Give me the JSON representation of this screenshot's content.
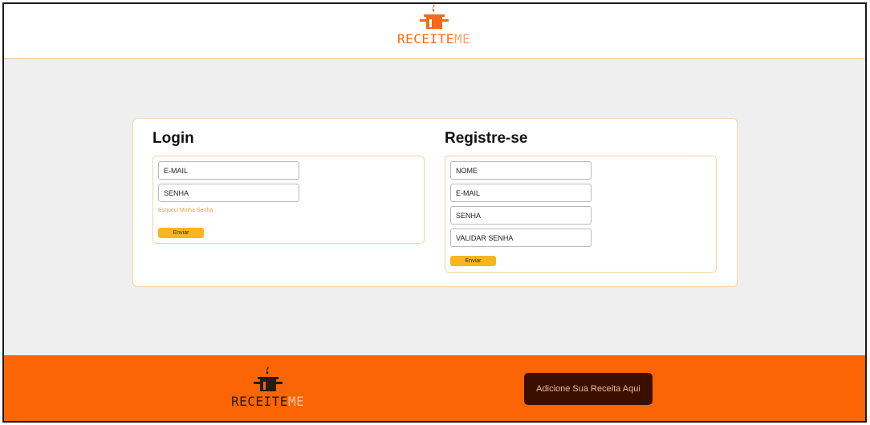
{
  "brand": {
    "name_part1": "RECEITE",
    "name_part2": "ME",
    "steam_glyph": "♦",
    "accent_color": "#f26b1d",
    "footer_color": "#fb6505"
  },
  "login": {
    "title": "Login",
    "email_placeholder": "E-MAIL",
    "password_placeholder": "SENHA",
    "forgot_link": "Esqueci Minha Senha",
    "submit_label": "Enviar"
  },
  "register": {
    "title": "Registre-se",
    "name_placeholder": "NOME",
    "email_placeholder": "E-MAIL",
    "password_placeholder": "SENHA",
    "confirm_placeholder": "VALIDAR SENHA",
    "submit_label": "Enviar"
  },
  "footer": {
    "cta_label": "Adicione Sua Receita Aqui"
  }
}
